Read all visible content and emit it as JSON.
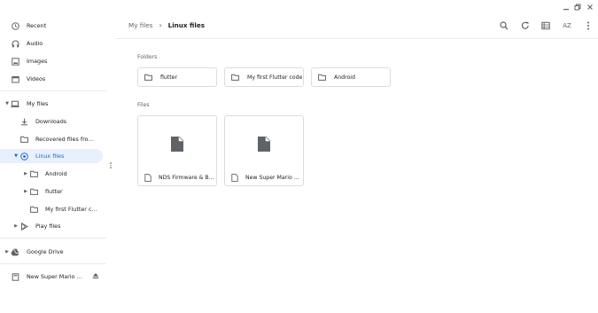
{
  "window": {
    "minimize_icon": "minimize-icon",
    "maximize_icon": "maximize-icon",
    "close_icon": "close-icon"
  },
  "sidebar": {
    "recent": "Recent",
    "audio": "Audio",
    "images": "Images",
    "videos": "Videos",
    "my_files": "My files",
    "downloads": "Downloads",
    "recovered": "Recovered files from ...",
    "linux_files": "Linux files",
    "android": "Android",
    "flutter": "flutter",
    "my_first_flutter": "My first Flutter co...",
    "play_files": "Play files",
    "google_drive": "Google Drive",
    "removable": "New Super Mario Bro..."
  },
  "breadcrumb": {
    "root": "My files",
    "separator": "›",
    "current": "Linux files"
  },
  "toolbar": {
    "sort_label": "AZ"
  },
  "content": {
    "folders_title": "Folders",
    "files_title": "Files",
    "folders": [
      "flutter",
      "My first Flutter code",
      "Android"
    ],
    "files": [
      "NDS Firmware & BI...",
      "New Super Mario Br..."
    ]
  },
  "colors": {
    "accent": "#1967d2",
    "selected_bg": "#e8f0fe",
    "icon": "#5f6368",
    "border": "#dadce0"
  }
}
